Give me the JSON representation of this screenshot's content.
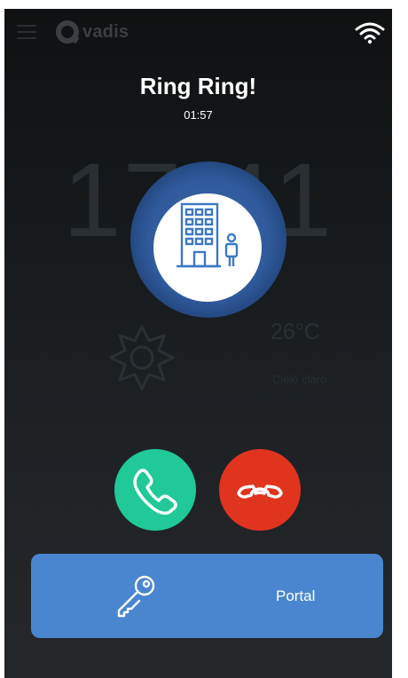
{
  "header": {
    "logo_text": "vadis",
    "menu_icon": "hamburger-menu-icon",
    "wifi_icon": "wifi-icon"
  },
  "call": {
    "title": "Ring Ring!",
    "timer": "01:57",
    "caller_icon": "building-with-person-icon"
  },
  "background": {
    "clock": "17:41",
    "temperature": "26°C",
    "weather_description": "Cielo claro",
    "weather_icon": "sun-icon"
  },
  "actions": {
    "answer_icon": "phone-icon",
    "hangup_icon": "hangup-phone-icon",
    "door_label": "Portal",
    "door_icon": "key-icon"
  },
  "colors": {
    "answer": "#20c997",
    "hangup": "#e0341f",
    "door_button": "#4a86cf",
    "caller_glow": "#2f5a9b"
  }
}
